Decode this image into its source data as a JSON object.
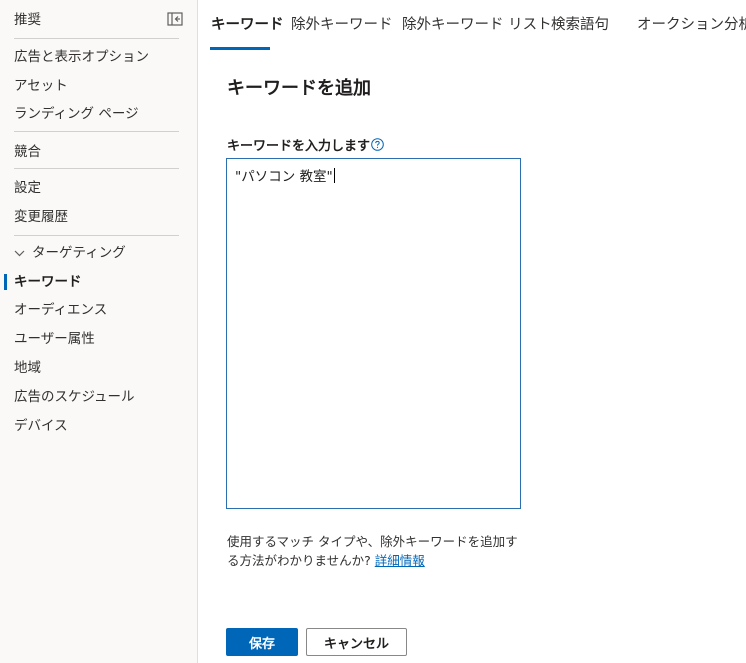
{
  "sidebar": {
    "recommend": "推奨",
    "items_top": [
      "広告と表示オプション",
      "アセット",
      "ランディング ページ"
    ],
    "competition": "競合",
    "settings": "設定",
    "history": "変更履歴",
    "targeting": "ターゲティング",
    "targeting_items": [
      "キーワード",
      "オーディエンス",
      "ユーザー属性",
      "地域",
      "広告のスケジュール",
      "デバイス"
    ],
    "active_item": "キーワード"
  },
  "tabs": [
    "キーワード",
    "除外キーワード",
    "除外キーワード リスト",
    "検索語句",
    "オークション分析"
  ],
  "main": {
    "title": "キーワードを追加",
    "field_label": "キーワードを入力します",
    "keyword_value": "\"パソコン 教室\"",
    "help_text": "使用するマッチ タイプや、除外キーワードを追加する方法がわかりませんか?",
    "help_link": "詳細情報",
    "save_label": "保存",
    "cancel_label": "キャンセル"
  },
  "colors": {
    "accent": "#0067b8",
    "sidebar_bg": "#faf9f8"
  },
  "icons": {
    "collapse": "collapse-panel-icon",
    "help": "question-circle-icon",
    "targeting": "chevron-down-icon"
  }
}
